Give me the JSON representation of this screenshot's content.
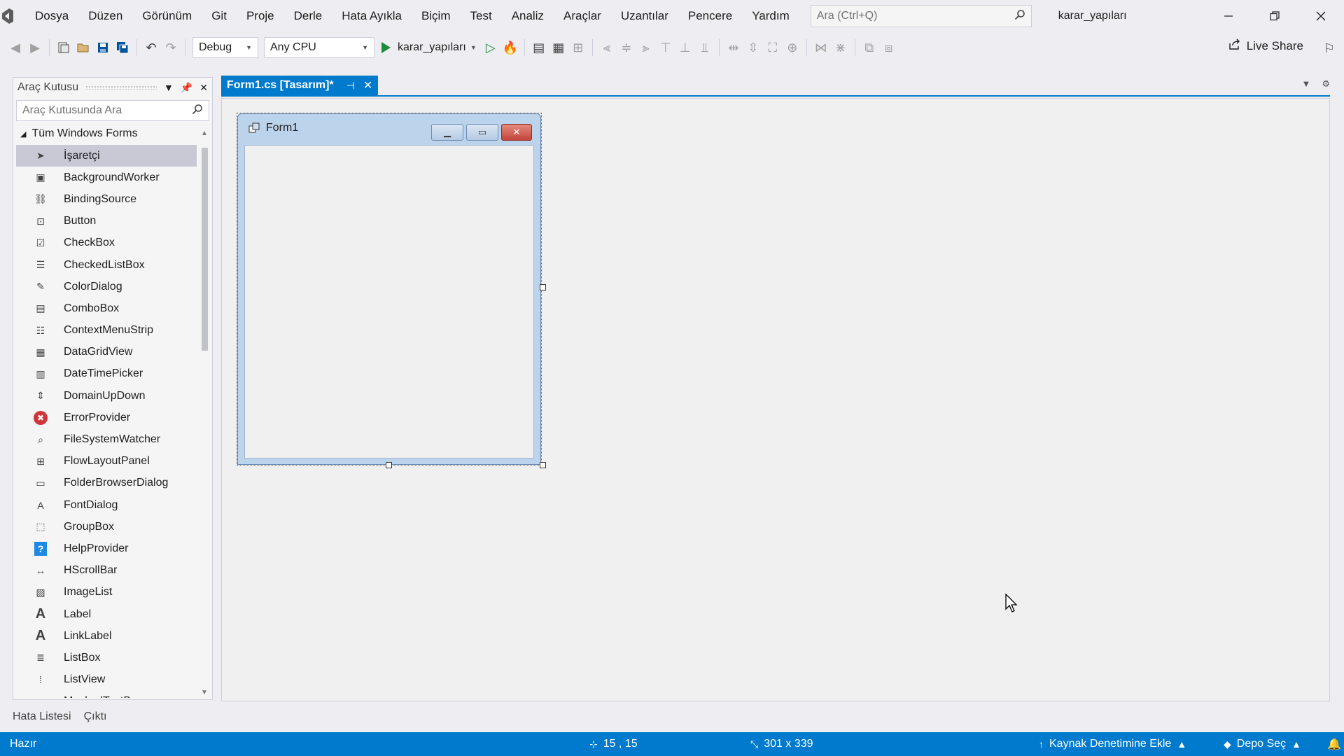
{
  "menu": {
    "items": [
      "Dosya",
      "Düzen",
      "Görünüm",
      "Git",
      "Proje",
      "Derle",
      "Hata Ayıkla",
      "Biçim",
      "Test",
      "Analiz",
      "Araçlar",
      "Uzantılar",
      "Pencere",
      "Yardım"
    ],
    "search_placeholder": "Ara (Ctrl+Q)",
    "solution_name": "karar_yapıları"
  },
  "toolbar": {
    "config": "Debug",
    "platform": "Any CPU",
    "run_target": "karar_yapıları",
    "live_share": "Live Share"
  },
  "toolbox": {
    "title": "Araç Kutusu",
    "search_placeholder": "Araç Kutusunda Ara",
    "group": "Tüm Windows Forms",
    "items": [
      {
        "label": "İşaretçi",
        "icon": "pointer-icon"
      },
      {
        "label": "BackgroundWorker",
        "icon": "background-worker-icon"
      },
      {
        "label": "BindingSource",
        "icon": "binding-source-icon"
      },
      {
        "label": "Button",
        "icon": "button-icon"
      },
      {
        "label": "CheckBox",
        "icon": "checkbox-icon"
      },
      {
        "label": "CheckedListBox",
        "icon": "checked-list-icon"
      },
      {
        "label": "ColorDialog",
        "icon": "color-dialog-icon"
      },
      {
        "label": "ComboBox",
        "icon": "combobox-icon"
      },
      {
        "label": "ContextMenuStrip",
        "icon": "context-menu-icon"
      },
      {
        "label": "DataGridView",
        "icon": "datagrid-icon"
      },
      {
        "label": "DateTimePicker",
        "icon": "calendar-icon"
      },
      {
        "label": "DomainUpDown",
        "icon": "updown-icon"
      },
      {
        "label": "ErrorProvider",
        "icon": "error-icon"
      },
      {
        "label": "FileSystemWatcher",
        "icon": "file-watcher-icon"
      },
      {
        "label": "FlowLayoutPanel",
        "icon": "flow-layout-icon"
      },
      {
        "label": "FolderBrowserDialog",
        "icon": "folder-icon"
      },
      {
        "label": "FontDialog",
        "icon": "font-dialog-icon"
      },
      {
        "label": "GroupBox",
        "icon": "groupbox-icon"
      },
      {
        "label": "HelpProvider",
        "icon": "help-icon"
      },
      {
        "label": "HScrollBar",
        "icon": "hscroll-icon"
      },
      {
        "label": "ImageList",
        "icon": "image-list-icon"
      },
      {
        "label": "Label",
        "icon": "label-icon"
      },
      {
        "label": "LinkLabel",
        "icon": "link-label-icon"
      },
      {
        "label": "ListBox",
        "icon": "listbox-icon"
      },
      {
        "label": "ListView",
        "icon": "listview-icon"
      },
      {
        "label": "MaskedTextBox",
        "icon": "masked-textbox-icon"
      }
    ]
  },
  "bottom_tabs": [
    "Hata Listesi",
    "Çıktı"
  ],
  "document": {
    "tab_label": "Form1.cs [Tasarım]*",
    "form_title": "Form1"
  },
  "status": {
    "ready": "Hazır",
    "position": "15 , 15",
    "size": "301 x 339",
    "source_control": "Kaynak Denetimine Ekle",
    "repo": "Depo Seç"
  }
}
